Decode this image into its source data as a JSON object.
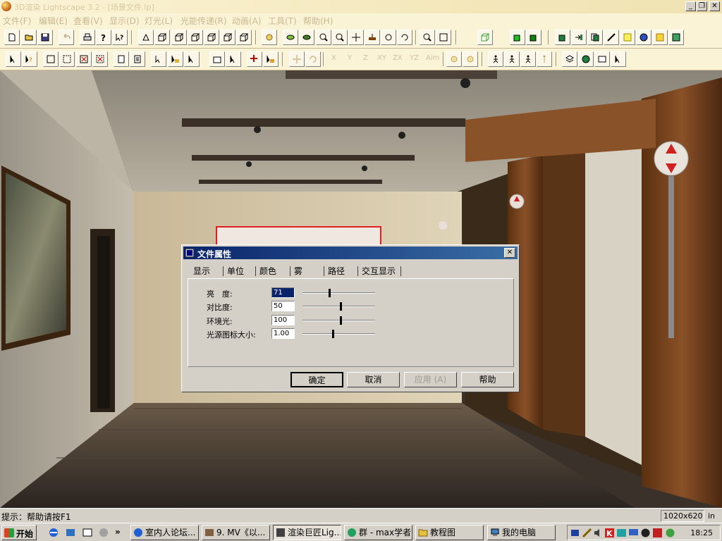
{
  "window": {
    "title": "3D渲染 Lightscape 3.2 - [场景文件.lp]"
  },
  "menu": [
    {
      "label": "文件(F)"
    },
    {
      "label": "编辑(E)"
    },
    {
      "label": "查看(V)"
    },
    {
      "label": "显示(D)"
    },
    {
      "label": "灯光(L)"
    },
    {
      "label": "光能传递(R)"
    },
    {
      "label": "动画(A)"
    },
    {
      "label": "工具(T)"
    },
    {
      "label": "帮助(H)"
    }
  ],
  "toolbar2_axes": {
    "x": "X",
    "y": "Y",
    "z": "Z",
    "xy": "XY",
    "zx": "ZX",
    "yz": "YZ",
    "aim": "Aim"
  },
  "dialog": {
    "title": "文件属性",
    "close": "✕",
    "tabs": [
      "显示",
      "单位",
      "颜色",
      "雾",
      "路径",
      "交互显示"
    ],
    "fields": [
      {
        "label": "亮　度:",
        "value": "71",
        "slider": 0.37
      },
      {
        "label": "对比度:",
        "value": "50",
        "slider": 0.53
      },
      {
        "label": "环境光:",
        "value": "100",
        "slider": 0.53
      },
      {
        "label": "光源图标大小:",
        "value": "1.00",
        "slider": 0.42
      }
    ],
    "buttons": {
      "ok": "确定",
      "cancel": "取消",
      "apply": "应用 (A)",
      "help": "帮助"
    }
  },
  "status": {
    "hint": "提示：帮助请按F1",
    "resolution": "1020x620",
    "unit": "in"
  },
  "taskbar": {
    "start": "开始",
    "quicklaunch_more": "»",
    "tasks": [
      {
        "label": "室内人论坛..."
      },
      {
        "label": "9. MV《以..."
      },
      {
        "label": "渲染巨匠Lig..."
      },
      {
        "label": "群 - max学者"
      },
      {
        "label": "教程图"
      },
      {
        "label": "我的电脑"
      }
    ],
    "clock": "18:25"
  }
}
